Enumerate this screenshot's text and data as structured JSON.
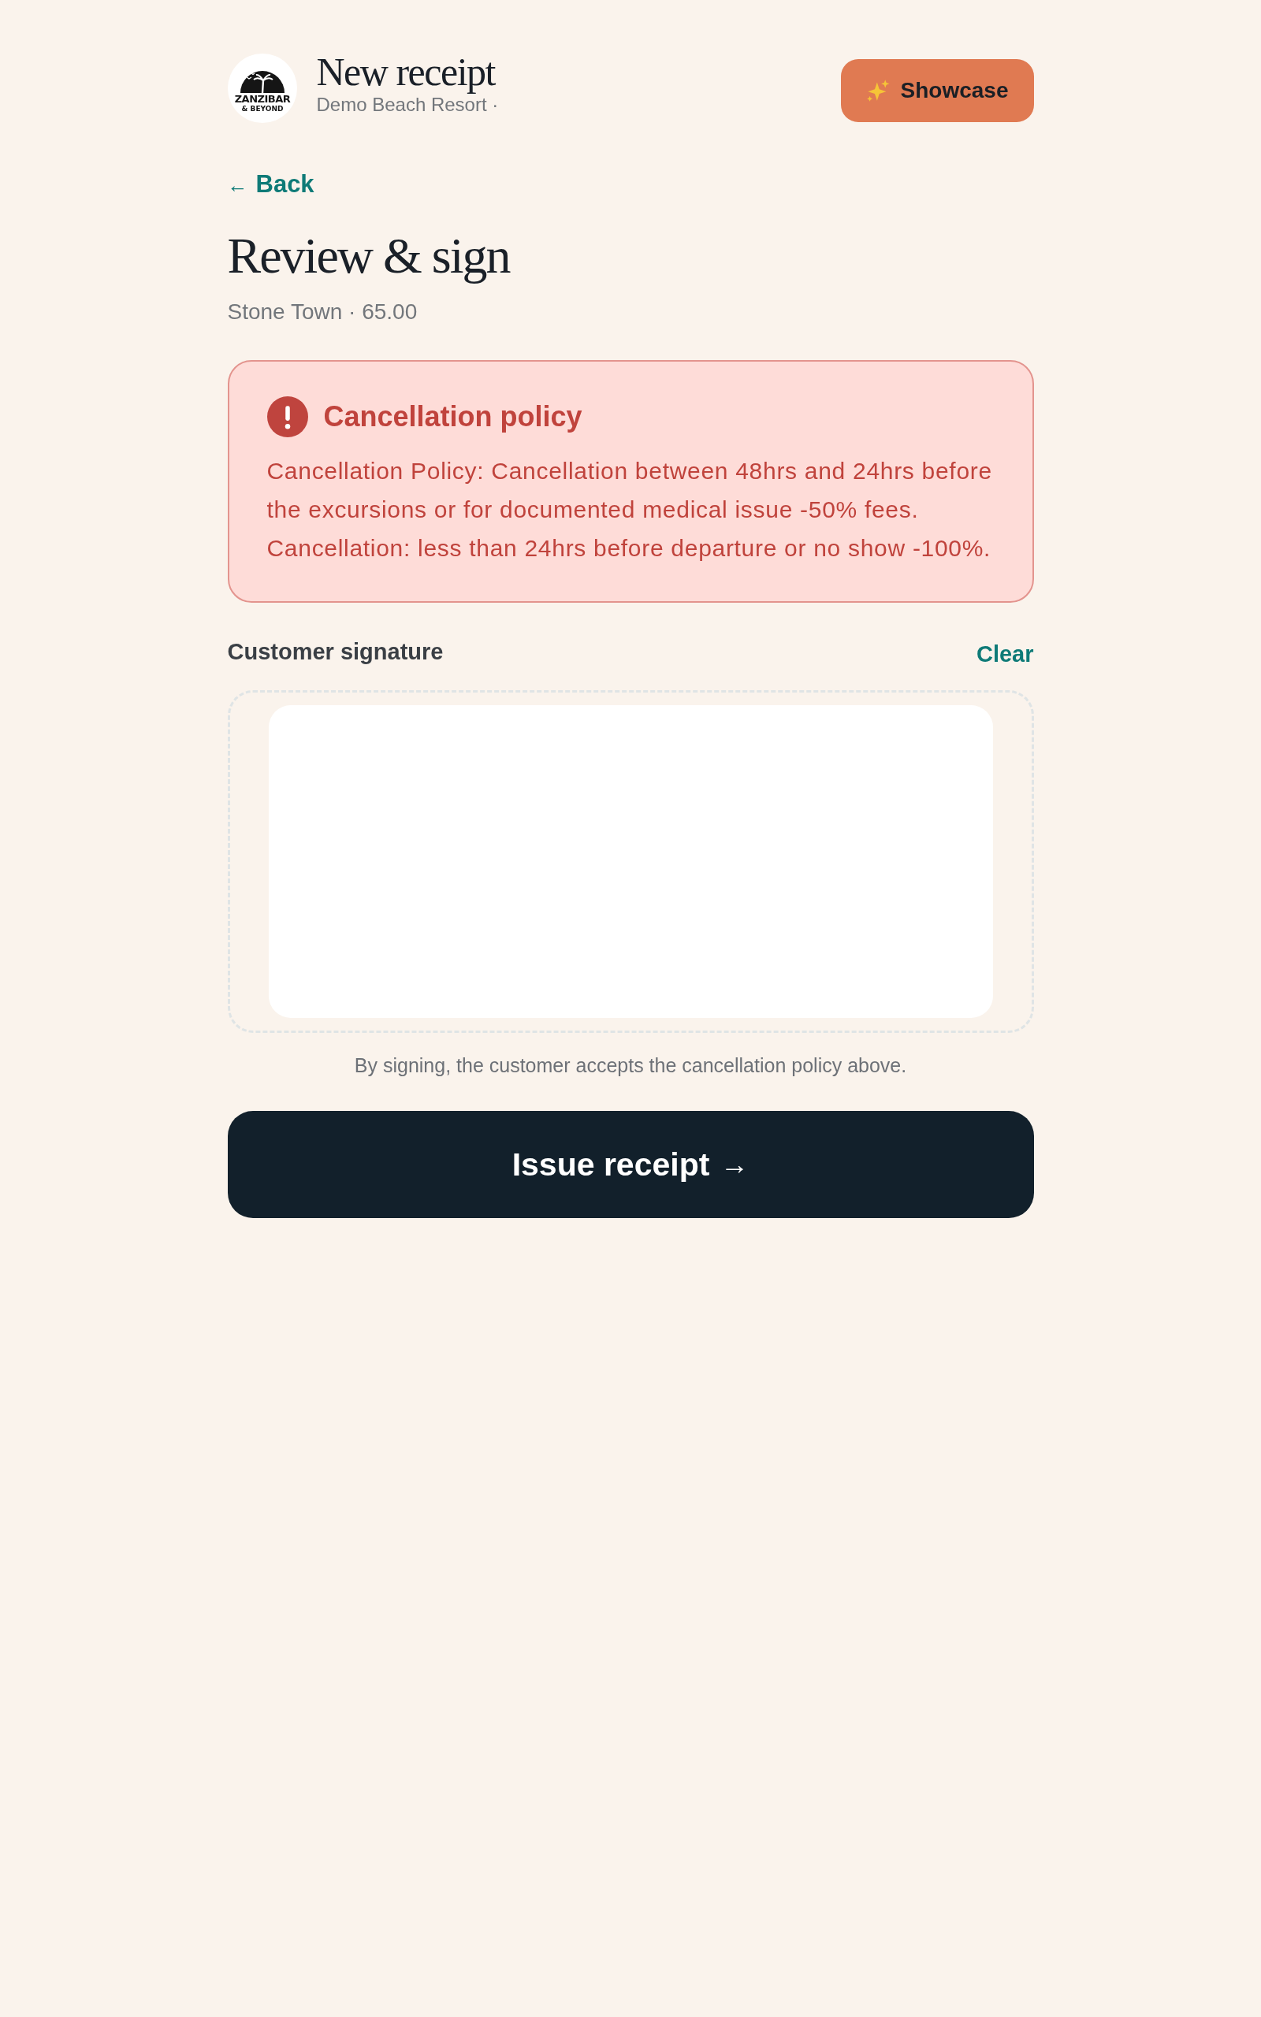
{
  "header": {
    "logo": {
      "line_1": "ZANZIBAR",
      "line_2": "& BEYOND"
    },
    "title": "New receipt",
    "subtitle": "Demo Beach Resort ·",
    "action": {
      "label": "Showcase"
    }
  },
  "back": {
    "arrow": "←",
    "label": "Back"
  },
  "page": {
    "title": "Review & sign",
    "subtitle": "Stone Town · 65.00"
  },
  "alert": {
    "title": "Cancellation policy",
    "body": "Cancellation Policy: Cancellation between 48hrs and 24hrs before the excursions or for documented medical issue -50% fees. Cancellation: less than 24hrs before departure or no show -100%."
  },
  "signature": {
    "label": "Customer signature",
    "clear": "Clear",
    "note": "By signing, the customer accepts the cancellation policy above."
  },
  "submit": {
    "label": "Issue receipt",
    "arrow": "→"
  }
}
